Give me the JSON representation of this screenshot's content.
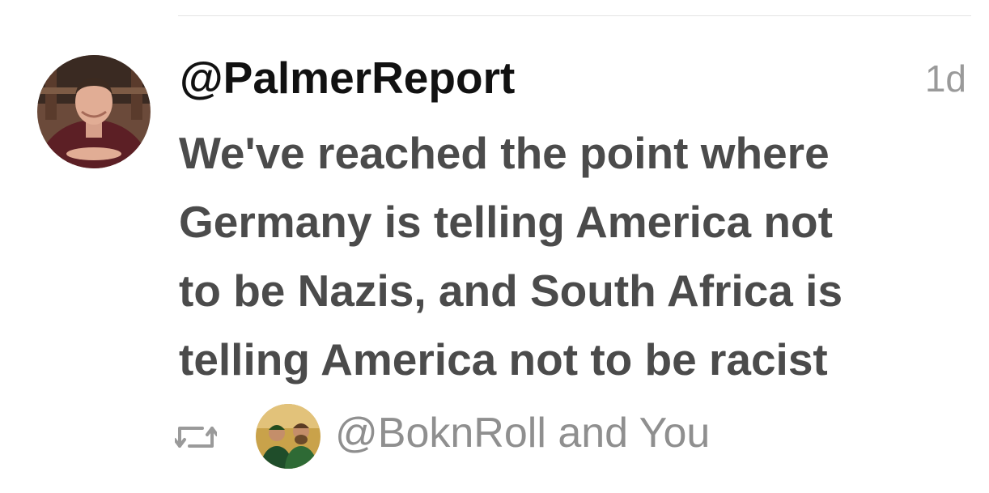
{
  "tweet": {
    "username": "@PalmerReport",
    "timestamp": "1d",
    "text_lines": [
      "We've reached the point where",
      "Germany is telling America not",
      "to be Nazis, and South Africa is",
      "telling America not to be racist"
    ]
  },
  "retweet": {
    "icon": "retweet-icon",
    "text": "@BoknRoll and You"
  },
  "colors": {
    "username": "#111111",
    "body_text": "#4b4b4b",
    "muted": "#9a9a9a",
    "divider": "#e3e3e3"
  }
}
